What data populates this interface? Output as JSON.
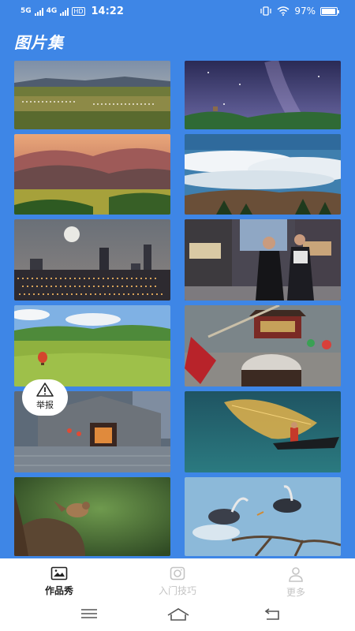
{
  "status_bar": {
    "network_1": "5G",
    "network_2": "4G",
    "hd": "HD",
    "time": "14:22",
    "battery": "97%",
    "battery_level": 0.97
  },
  "page_title": "图片集",
  "photos": [
    {
      "icon": "grassland-landscape-photo"
    },
    {
      "icon": "starry-night-sky-photo"
    },
    {
      "icon": "mountain-valley-sunset-photo"
    },
    {
      "icon": "sea-of-clouds-photo"
    },
    {
      "icon": "city-skyline-moon-photo"
    },
    {
      "icon": "ethnic-costume-couple-street-photo"
    },
    {
      "icon": "hot-air-balloon-meadow-photo"
    },
    {
      "icon": "drum-performance-photo"
    },
    {
      "icon": "stone-cottage-lanterns-photo"
    },
    {
      "icon": "fisherman-casting-net-photo"
    },
    {
      "icon": "sparrow-on-branch-photo"
    },
    {
      "icon": "herons-on-branch-photo"
    }
  ],
  "report": {
    "label": "举报",
    "icon": "warning-triangle-icon"
  },
  "tabs": [
    {
      "label": "作品秀",
      "icon": "image-icon",
      "active": true
    },
    {
      "label": "入门技巧",
      "icon": "camera-icon",
      "active": false
    },
    {
      "label": "更多",
      "icon": "person-icon",
      "active": false
    }
  ],
  "colors": {
    "background": "#3e86e6",
    "tab_active": "#222222",
    "tab_inactive": "#c4c4c4"
  }
}
